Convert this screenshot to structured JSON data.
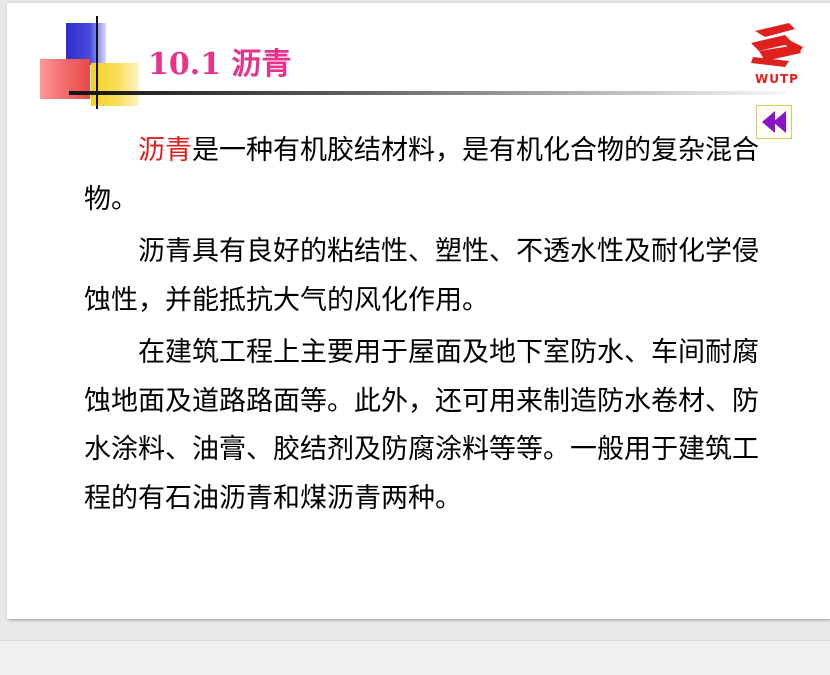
{
  "slide": {
    "title": "10.1 沥青",
    "logo_text": "WUTP",
    "paragraphs": [
      {
        "highlight": "沥青",
        "text": "是一种有机胶结材料，是有机化合物的复杂混合物。"
      },
      {
        "highlight": "",
        "text": "沥青具有良好的粘结性、塑性、不透水性及耐化学侵蚀性，并能抵抗大气的风化作用。"
      },
      {
        "highlight": "",
        "text": "在建筑工程上主要用于屋面及地下室防水、车间耐腐蚀地面及道路路面等。此外，还可用来制造防水卷材、防水涂料、油膏、胶结剂及防腐涂料等等。一般用于建筑工程的有石油沥青和煤沥青两种。"
      }
    ]
  },
  "icons": {
    "back": "double-chevron-left-icon",
    "logo": "wutp-logo-icon"
  },
  "colors": {
    "title": "#e8328b",
    "highlight": "#e0201c",
    "logo": "#e0201c",
    "back_arrow": "#8a14c8"
  }
}
